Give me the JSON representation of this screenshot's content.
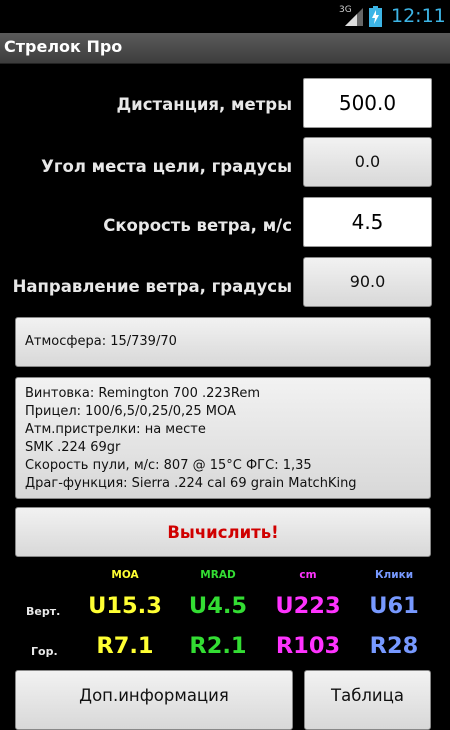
{
  "status_bar": {
    "network": "3G",
    "time": "12:11",
    "icons": [
      "signal-icon",
      "battery-charging-icon"
    ]
  },
  "app": {
    "title": "Стрелок Про"
  },
  "fields": [
    {
      "label": "Дистанция, метры",
      "value": "500.0"
    },
    {
      "label": "Угол места цели, градусы",
      "value": "0.0"
    },
    {
      "label": "Скорость ветра, м/с",
      "value": "4.5"
    },
    {
      "label": "Направление ветра, градусы",
      "value": "90.0"
    }
  ],
  "atmosphere": "Атмосфера: 15/739/70",
  "rifle_info": [
    "Винтовка: Remington 700 .223Rem",
    "Прицел: 100/6,5/0,25/0,25 MOA",
    "Атм.пристрелки: на месте",
    "SMK .224 69gr",
    "Скорость пули, м/с: 807 @ 15°C ФГС: 1,35",
    "Драг-функция: Sierra .224 cal 69 grain MatchKing"
  ],
  "calculate_label": "Вычислить!",
  "results": {
    "columns": [
      "MOA",
      "MRAD",
      "cm",
      "Клики"
    ],
    "rows": [
      {
        "label": "Верт.",
        "values": [
          "U15.3",
          "U4.5",
          "U223",
          "U61"
        ]
      },
      {
        "label": "Гор.",
        "values": [
          "R7.1",
          "R2.1",
          "R103",
          "R28"
        ]
      }
    ]
  },
  "more_info_label": "Доп.информация",
  "table_label": "Таблица",
  "colors": {
    "moa": "#ffff33",
    "mrad": "#33dd33",
    "cm": "#ff33ff",
    "clicks": "#7799ff",
    "calculate_text": "#d00000",
    "clock": "#3db5e6"
  }
}
